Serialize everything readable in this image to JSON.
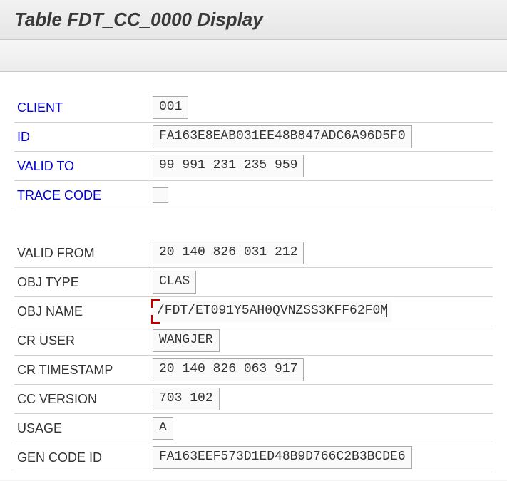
{
  "header": {
    "title": "Table FDT_CC_0000 Display"
  },
  "fields": {
    "client": {
      "label": "CLIENT",
      "value": "001"
    },
    "id": {
      "label": "ID",
      "value": "FA163E8EAB031EE48B847ADC6A96D5F0"
    },
    "valid_to": {
      "label": "VALID TO",
      "value": "99 991 231 235 959"
    },
    "trace_code": {
      "label": "TRACE CODE",
      "value": ""
    },
    "valid_from": {
      "label": "VALID FROM",
      "value": "20 140 826 031 212"
    },
    "obj_type": {
      "label": "OBJ TYPE",
      "value": "CLAS"
    },
    "obj_name": {
      "label": "OBJ NAME",
      "value": "/FDT/ET091Y5AH0QVNZSS3KFF62F0M"
    },
    "cr_user": {
      "label": "CR USER",
      "value": "WANGJER"
    },
    "cr_timestamp": {
      "label": "CR TIMESTAMP",
      "value": "20 140 826 063 917"
    },
    "cc_version": {
      "label": "CC VERSION",
      "value": "703 102"
    },
    "usage": {
      "label": "USAGE",
      "value": "A"
    },
    "gen_code_id": {
      "label": "GEN CODE ID",
      "value": "FA163EEF573D1ED48B9D766C2B3BCDE6"
    }
  }
}
